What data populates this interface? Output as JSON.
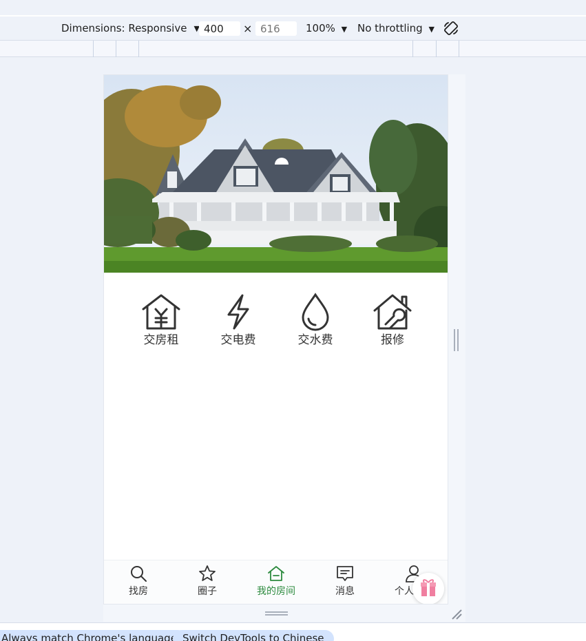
{
  "toolbar": {
    "dimensions_label": "Dimensions: Responsive",
    "width_value": "400",
    "height_placeholder": "616",
    "times_symbol": "×",
    "zoom_label": "100%",
    "throttle_label": "No throttling",
    "dropdown_caret": "▼"
  },
  "services": [
    {
      "label": "交房租",
      "icon": "house-yen-icon"
    },
    {
      "label": "交电费",
      "icon": "lightning-icon"
    },
    {
      "label": "交水费",
      "icon": "water-drop-icon"
    },
    {
      "label": "报修",
      "icon": "house-wrench-icon"
    }
  ],
  "tabs": [
    {
      "label": "找房",
      "icon": "search-icon",
      "active": false
    },
    {
      "label": "圈子",
      "icon": "star-icon",
      "active": false
    },
    {
      "label": "我的房间",
      "icon": "home-icon",
      "active": true
    },
    {
      "label": "消息",
      "icon": "message-icon",
      "active": false
    },
    {
      "label": "个人中心",
      "icon": "user-icon",
      "active": false
    }
  ],
  "colors": {
    "accent": "#2c8a3e",
    "icon": "#333333",
    "devtools_bg": "#eef2f9",
    "chip_bg": "#d3e3fd"
  },
  "hero_image": "house-photo",
  "footer": {
    "chip_language": "Always match Chrome's language",
    "chip_switch": "Switch DevTools to Chinese"
  }
}
